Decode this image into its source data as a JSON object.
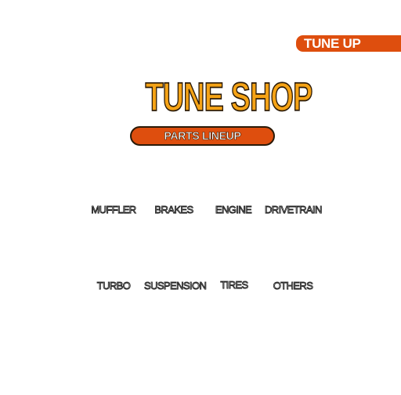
{
  "header": {
    "tab_label": "TUNE UP",
    "title": "TUNE SHOP",
    "subtitle": "PARTS LINEUP"
  },
  "menu": {
    "row1": [
      "MUFFLER",
      "BRAKES",
      "ENGINE",
      "DRIVETRAIN"
    ],
    "row2": [
      "TURBO",
      "SUSPENSION",
      "TIRES",
      "OTHERS"
    ]
  },
  "colors": {
    "accent_orange": "#de4e0e",
    "title_yellow": "#f5a316",
    "outline": "#2a1a08"
  }
}
